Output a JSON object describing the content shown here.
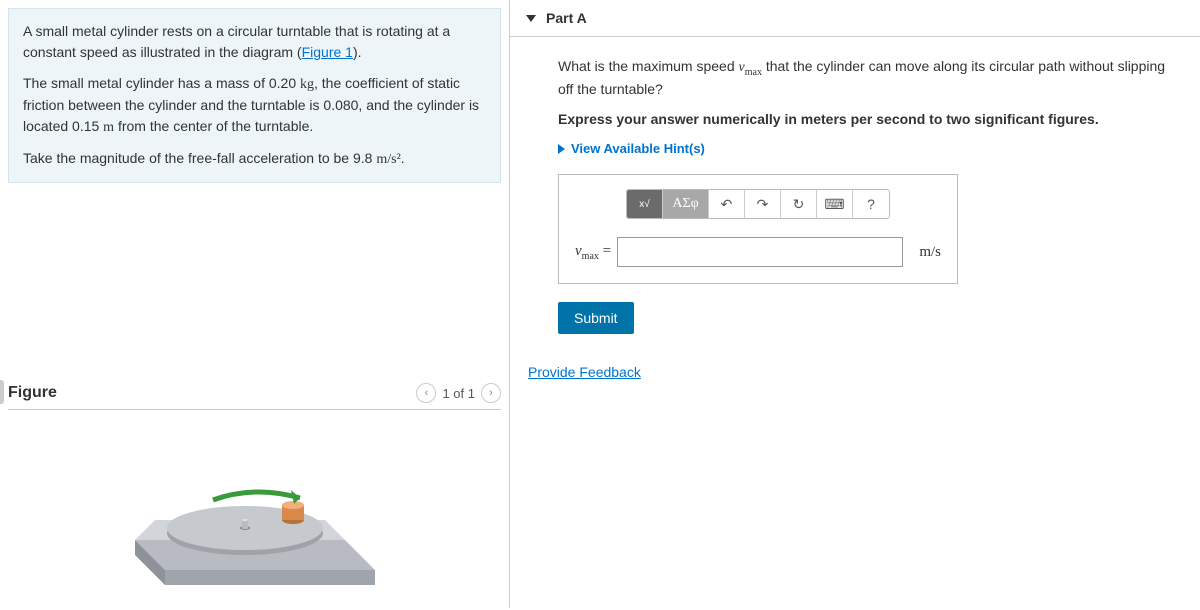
{
  "problem": {
    "p1_a": "A small metal cylinder rests on a circular turntable that is rotating at a constant speed as illustrated in the diagram (",
    "p1_link": "Figure 1",
    "p1_b": ").",
    "p2": "The small metal cylinder has a mass of 0.20 kg, the coefficient of static friction between the cylinder and the turntable is 0.080, and the cylinder is located 0.15 m from the center of the turntable.",
    "p3": "Take the magnitude of the free-fall acceleration to be 9.8 m/s²."
  },
  "figure": {
    "title": "Figure",
    "pager": "1 of 1"
  },
  "part": {
    "title": "Part A",
    "question_a": "What is the maximum speed ",
    "question_var": "v",
    "question_sub": "max",
    "question_b": " that the cylinder can move along its circular path without slipping off the turntable?",
    "instruction": "Express your answer numerically in meters per second to two significant figures.",
    "hints_label": "View Available Hint(s)",
    "toolbar": {
      "templates": "√x",
      "greek": "ΑΣφ",
      "undo": "↶",
      "redo": "↷",
      "reset": "↻",
      "keyboard": "⌨",
      "help": "?"
    },
    "var_label_v": "v",
    "var_label_sub": "max",
    "equals": " = ",
    "unit": "m/s",
    "submit": "Submit"
  },
  "feedback": "Provide Feedback"
}
